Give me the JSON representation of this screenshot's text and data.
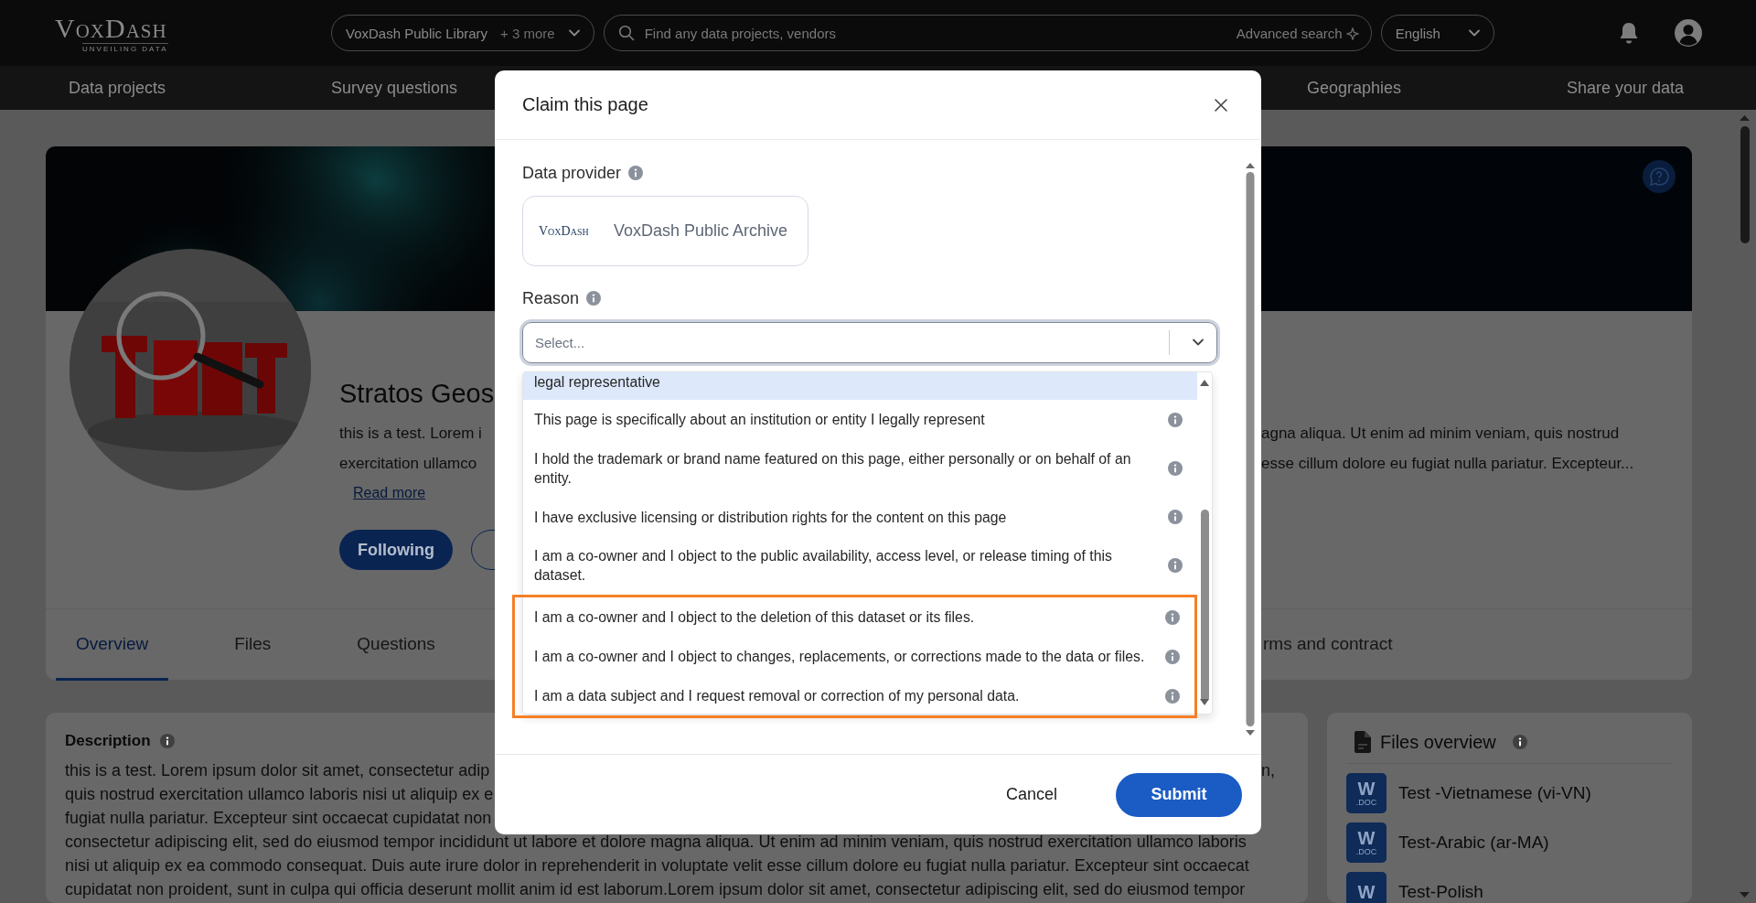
{
  "header": {
    "logo": "VoxDash",
    "tagline": "UNVEILING DATA",
    "library_selector": {
      "label": "VoxDash Public Library",
      "extra": "+ 3 more"
    },
    "search": {
      "placeholder": "Find any data projects, vendors",
      "advanced": "Advanced search"
    },
    "language": "English"
  },
  "nav": [
    "Data projects",
    "Survey questions",
    "Geographies",
    "Share your data"
  ],
  "project": {
    "title": "Stratos Geos",
    "summary": [
      {
        "left": "this is a test. Lorem i",
        "right": "agna aliqua. Ut enim ad minim veniam, quis nostrud"
      },
      {
        "left": "exercitation ullamco",
        "right": "esse cillum dolore eu fugiat nulla pariatur. Excepteur..."
      }
    ],
    "read_more": "Read more",
    "follow_button": "Following",
    "tabs": [
      {
        "label": "Overview",
        "selected": true
      },
      {
        "label": "Files",
        "selected": false
      },
      {
        "label": "Questions",
        "selected": false
      },
      {
        "label": "rms and contract",
        "selected": false
      }
    ]
  },
  "description": {
    "title": "Description",
    "lines": [
      {
        "left": "this is a test. Lorem ipsum dolor sit amet, consectetur adip",
        "right": "n,"
      },
      {
        "left": "quis nostrud exercitation ullamco laboris nisi ut aliquip ex e"
      },
      {
        "left": "fugiat nulla pariatur. Excepteur sint occaecat cupidatat non"
      },
      {
        "text": "consectetur adipiscing elit, sed do eiusmod tempor incididunt ut labore et dolore magna aliqua. Ut enim ad minim veniam, quis nostrud exercitation ullamco laboris"
      },
      {
        "text": "nisi ut aliquip ex ea commodo consequat. Duis aute irure dolor in reprehenderit in voluptate velit esse cillum dolore eu fugiat nulla pariatur. Excepteur sint occaecat"
      },
      {
        "text": "cupidatat non proident, sunt in culpa qui officia deserunt mollit anim id est laborum.Lorem ipsum dolor sit amet, consectetur adipiscing elit, sed do eiusmod tempor"
      }
    ]
  },
  "files_overview": {
    "title": "Files overview",
    "files": [
      {
        "name": "Test -Vietnamese (vi-VN)",
        "badge": "W",
        "ext": ".DOC"
      },
      {
        "name": "Test-Arabic (ar-MA)",
        "badge": "W",
        "ext": ".DOC"
      },
      {
        "name": "Test-Polish",
        "badge": "W"
      }
    ]
  },
  "modal": {
    "title": "Claim this page",
    "provider_label": "Data provider",
    "provider": {
      "logo": "VoxDash",
      "name": "VoxDash Public Archive"
    },
    "reason_label": "Reason",
    "reason_placeholder": "Select...",
    "options": [
      {
        "text": "legal representative",
        "focused": true,
        "highlighted": false
      },
      {
        "text": "This page is specifically about an institution or entity I legally represent",
        "focused": false,
        "highlighted": false
      },
      {
        "text": "I hold the trademark or brand name featured on this page, either personally or on behalf of an entity.",
        "focused": false,
        "highlighted": false
      },
      {
        "text": "I have exclusive licensing or distribution rights for the content on this page",
        "focused": false,
        "highlighted": false
      },
      {
        "text": "I am a co-owner and I object to the public availability, access level, or release timing of this dataset.",
        "focused": false,
        "highlighted": false
      },
      {
        "text": "I am a co-owner and I object to the deletion of this dataset or its files.",
        "focused": false,
        "highlighted": true
      },
      {
        "text": "I am a co-owner and I object to changes, replacements, or corrections made to the data or files.",
        "focused": false,
        "highlighted": true
      },
      {
        "text": "I am a data subject and I request removal or correction of my personal data.",
        "focused": false,
        "highlighted": true
      }
    ],
    "cancel": "Cancel",
    "submit": "Submit"
  }
}
